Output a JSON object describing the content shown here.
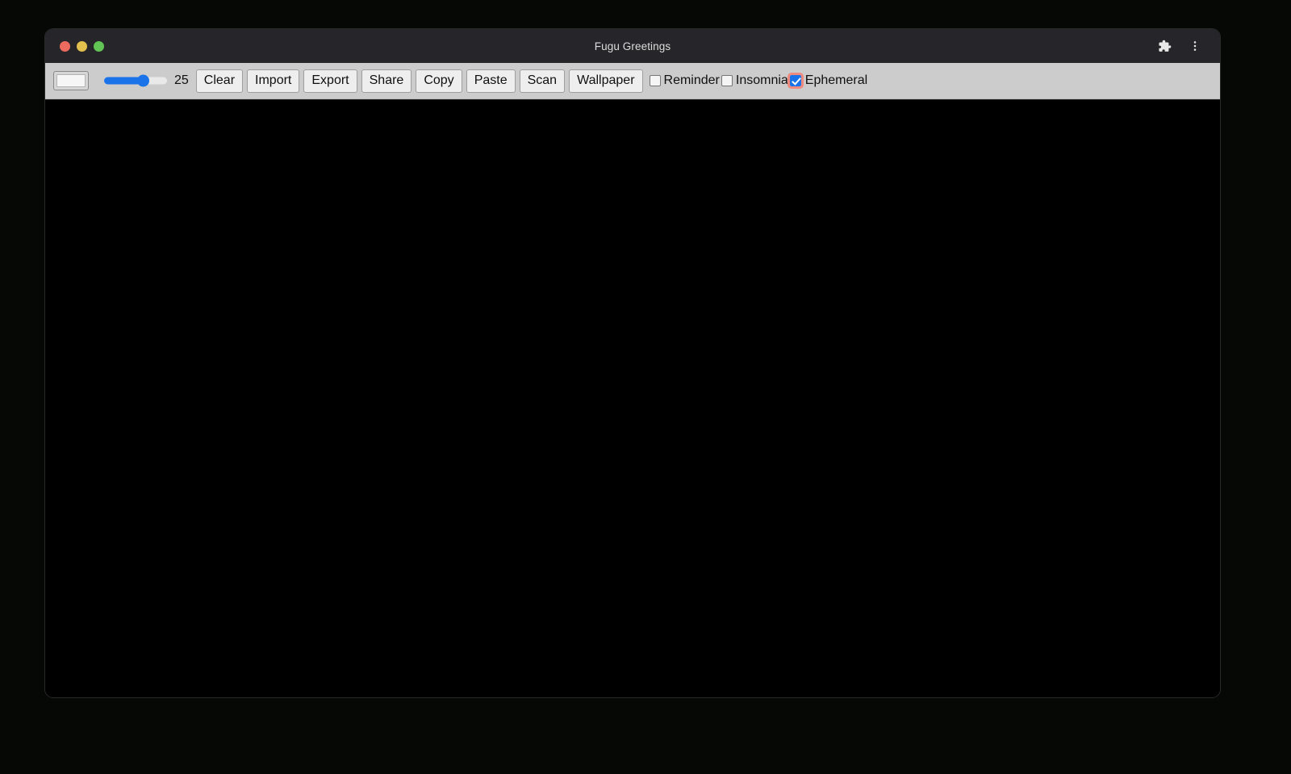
{
  "window": {
    "title": "Fugu Greetings",
    "traffic_lights": [
      {
        "name": "close",
        "color": "#ED6A5E"
      },
      {
        "name": "minimize",
        "color": "#E3C04E"
      },
      {
        "name": "maximize",
        "color": "#61C454"
      }
    ],
    "actions": [
      {
        "icon": "puzzle-piece-icon",
        "label": "Extensions"
      },
      {
        "icon": "more-vertical-icon",
        "label": "Customize and control"
      }
    ]
  },
  "toolbar": {
    "color_picker": {
      "value": "#f6f6f6",
      "label": "Color"
    },
    "thickness": {
      "value": "25",
      "min": "1",
      "max": "40",
      "percent": 62,
      "fill_color": "#1a73e8"
    },
    "buttons": [
      {
        "label": "Clear"
      },
      {
        "label": "Import"
      },
      {
        "label": "Export"
      },
      {
        "label": "Share"
      },
      {
        "label": "Copy"
      },
      {
        "label": "Paste"
      },
      {
        "label": "Scan"
      },
      {
        "label": "Wallpaper"
      }
    ],
    "checkboxes": [
      {
        "label": "Reminder",
        "checked": false,
        "focused": false
      },
      {
        "label": "Insomnia",
        "checked": false,
        "focused": false
      },
      {
        "label": "Ephemeral",
        "checked": true,
        "focused": true
      }
    ],
    "background": "#cccccc"
  },
  "canvas": {
    "background": "#000000",
    "content": ""
  }
}
